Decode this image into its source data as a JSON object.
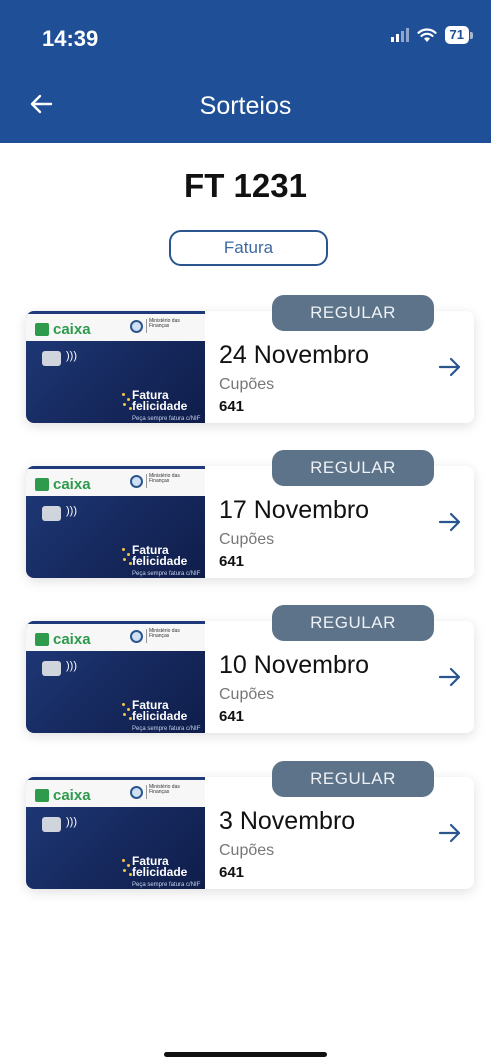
{
  "status_bar": {
    "time": "14:39",
    "battery": "71"
  },
  "header": {
    "title": "Sorteios"
  },
  "invoice": {
    "title": "FT 1231",
    "fatura_button": "Fatura"
  },
  "card_art": {
    "bank_name": "caixa",
    "ministry_text": "Ministério das Finanças",
    "promo_line1": "Fatura",
    "promo_line2": "felicidade",
    "promo_tagline": "Peça sempre fatura c/NIF"
  },
  "draws": [
    {
      "badge": "REGULAR",
      "date": "24 Novembro",
      "coupons_label": "Cupões",
      "coupons": "641"
    },
    {
      "badge": "REGULAR",
      "date": "17 Novembro",
      "coupons_label": "Cupões",
      "coupons": "641"
    },
    {
      "badge": "REGULAR",
      "date": "10 Novembro",
      "coupons_label": "Cupões",
      "coupons": "641"
    },
    {
      "badge": "REGULAR",
      "date": "3 Novembro",
      "coupons_label": "Cupões",
      "coupons": "641"
    }
  ],
  "colors": {
    "header_bg": "#1f4f96",
    "badge_bg": "#5c7389",
    "accent": "#2a558f"
  }
}
